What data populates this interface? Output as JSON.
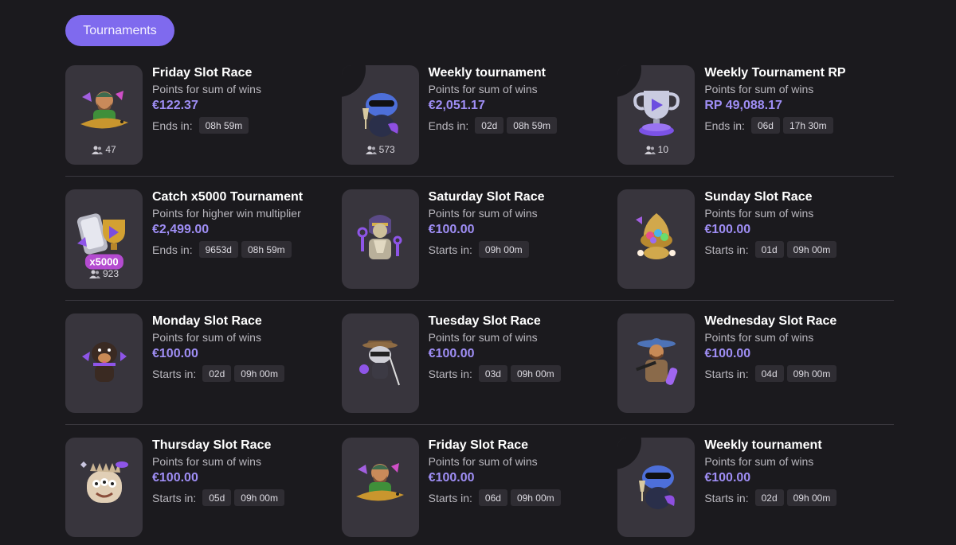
{
  "header": {
    "tab_label": "Tournaments"
  },
  "cards": [
    {
      "title": "Friday Slot Race",
      "subtitle": "Points for sum of wins",
      "prize": "€122.37",
      "timer_label": "Ends in:",
      "chips": [
        "08h 59m"
      ],
      "players": "47",
      "icon": "fisherman-icon"
    },
    {
      "title": "Weekly tournament",
      "subtitle": "Points for sum of wins",
      "prize": "€2,051.17",
      "timer_label": "Ends in:",
      "chips": [
        "02d",
        "08h 59m"
      ],
      "players": "573",
      "icon": "frog-icon"
    },
    {
      "title": "Weekly Tournament RP",
      "subtitle": "Points for sum of wins",
      "prize": "RP  49,088.17",
      "timer_label": "Ends in:",
      "chips": [
        "06d",
        "17h 30m"
      ],
      "players": "10",
      "icon": "trophy-icon"
    },
    {
      "title": "Catch x5000 Tournament",
      "subtitle": "Points for higher win multiplier",
      "prize": "€2,499.00",
      "timer_label": "Ends in:",
      "chips": [
        "9653d",
        "08h 59m"
      ],
      "players": "923",
      "icon": "phone-trophy-icon",
      "badge": "x5000"
    },
    {
      "title": "Saturday Slot Race",
      "subtitle": "Points for sum of wins",
      "prize": "€100.00",
      "timer_label": "Starts in:",
      "chips": [
        "09h 00m"
      ],
      "icon": "pharaoh-icon"
    },
    {
      "title": "Sunday Slot Race",
      "subtitle": "Points for sum of wins",
      "prize": "€100.00",
      "timer_label": "Starts in:",
      "chips": [
        "01d",
        "09h 00m"
      ],
      "icon": "egg-icon"
    },
    {
      "title": "Monday Slot Race",
      "subtitle": "Points for sum of wins",
      "prize": "€100.00",
      "timer_label": "Starts in:",
      "chips": [
        "02d",
        "09h 00m"
      ],
      "icon": "dog-icon"
    },
    {
      "title": "Tuesday Slot Race",
      "subtitle": "Points for sum of wins",
      "prize": "€100.00",
      "timer_label": "Starts in:",
      "chips": [
        "03d",
        "09h 00m"
      ],
      "icon": "raccoon-icon"
    },
    {
      "title": "Wednesday Slot Race",
      "subtitle": "Points for sum of wins",
      "prize": "€100.00",
      "timer_label": "Starts in:",
      "chips": [
        "04d",
        "09h 00m"
      ],
      "icon": "cowboy-icon"
    },
    {
      "title": "Thursday Slot Race",
      "subtitle": "Points for sum of wins",
      "prize": "€100.00",
      "timer_label": "Starts in:",
      "chips": [
        "05d",
        "09h 00m"
      ],
      "icon": "monster-icon"
    },
    {
      "title": "Friday Slot Race",
      "subtitle": "Points for sum of wins",
      "prize": "€100.00",
      "timer_label": "Starts in:",
      "chips": [
        "06d",
        "09h 00m"
      ],
      "icon": "fisherman-icon"
    },
    {
      "title": "Weekly tournament",
      "subtitle": "Points for sum of wins",
      "prize": "€100.00",
      "timer_label": "Starts in:",
      "chips": [
        "02d",
        "09h 00m"
      ],
      "icon": "frog-icon"
    }
  ],
  "colors": {
    "accent": "#7f6aee",
    "prize": "#9f8ef5",
    "background": "#1b1a1e",
    "card": "#38353d"
  }
}
